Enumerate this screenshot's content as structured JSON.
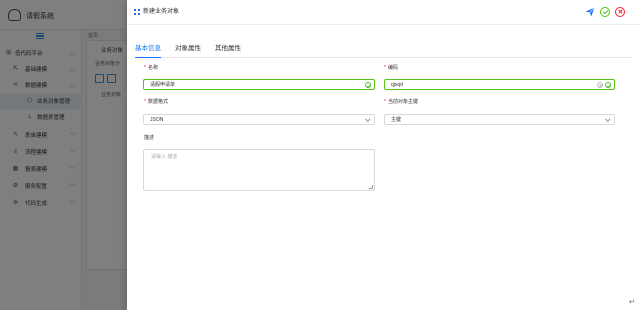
{
  "app": {
    "title": "请假系统"
  },
  "sidebar": {
    "items": [
      {
        "label": "低代码平台",
        "icon": "grid-icon",
        "arrow": "^"
      },
      {
        "label": "基础建模",
        "icon": "square-arrow-icon",
        "arrow": "^"
      },
      {
        "label": "数据建模",
        "icon": "share-icon",
        "arrow": "^"
      },
      {
        "label": "业务对象管理",
        "icon": "cube-icon",
        "arrow": ""
      },
      {
        "label": "数据表管理",
        "icon": "hierarchy-icon",
        "arrow": ""
      },
      {
        "label": "表单建模",
        "icon": "edit-icon",
        "arrow": "v"
      },
      {
        "label": "流程建模",
        "icon": "list-icon",
        "arrow": "v"
      },
      {
        "label": "报表建模",
        "icon": "table-icon",
        "arrow": "v"
      },
      {
        "label": "服务配置",
        "icon": "gear-icon",
        "arrow": "v"
      },
      {
        "label": "代码生成",
        "icon": "settings-icon",
        "arrow": "v"
      }
    ]
  },
  "background": {
    "tab": "首页",
    "card_title": "业务对象",
    "card_subtitle": "业务对象分",
    "tree_item": "业务对象"
  },
  "drawer": {
    "title": "新建业务对象",
    "tabs": [
      {
        "label": "基本信息",
        "active": true
      },
      {
        "label": "对象属性",
        "active": false
      },
      {
        "label": "其他属性",
        "active": false
      }
    ],
    "fields": {
      "name": {
        "label": "名称",
        "value": "请假申请单",
        "required": true
      },
      "code": {
        "label": "编码",
        "value": "qjsqd",
        "required": true
      },
      "format": {
        "label": "数据格式",
        "value": "JSON",
        "required": true
      },
      "primary_key": {
        "label": "当前对象主键",
        "value": "主键",
        "required": true
      },
      "description": {
        "label": "描述",
        "placeholder": "请输入 描述"
      }
    }
  },
  "colors": {
    "accent": "#1677ff",
    "success": "#52c41a",
    "danger": "#f5222d",
    "overlay": "rgba(0,0,0,0.5)"
  }
}
